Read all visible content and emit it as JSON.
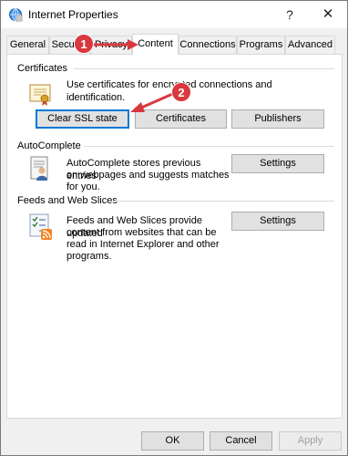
{
  "window": {
    "title": "Internet Properties",
    "help_glyph": "?",
    "close_glyph": "✕"
  },
  "tabs": [
    {
      "label": "General"
    },
    {
      "label": "Security"
    },
    {
      "label": "Privacy"
    },
    {
      "label": "Content",
      "active": true
    },
    {
      "label": "Connections"
    },
    {
      "label": "Programs"
    },
    {
      "label": "Advanced"
    }
  ],
  "certificates": {
    "heading": "Certificates",
    "description": "Use certificates for encrypted connections and identification.",
    "clear_ssl_label": "Clear SSL state",
    "certificates_label": "Certificates",
    "publishers_label": "Publishers"
  },
  "autocomplete": {
    "heading": "AutoComplete",
    "line1": "AutoComplete stores previous entries",
    "line2": "on webpages and suggests matches",
    "line3": "for you.",
    "settings_label": "Settings"
  },
  "feeds": {
    "heading": "Feeds and Web Slices",
    "line1": "Feeds and Web Slices provide updated",
    "line2": "content from websites that can be",
    "line3": "read in Internet Explorer and other",
    "line4": "programs.",
    "settings_label": "Settings"
  },
  "footer": {
    "ok_label": "OK",
    "cancel_label": "Cancel",
    "apply_label": "Apply"
  },
  "annotations": {
    "step1": "1",
    "step2": "2"
  },
  "colors": {
    "annotation": "#d9383f",
    "focus": "#0078d7"
  }
}
